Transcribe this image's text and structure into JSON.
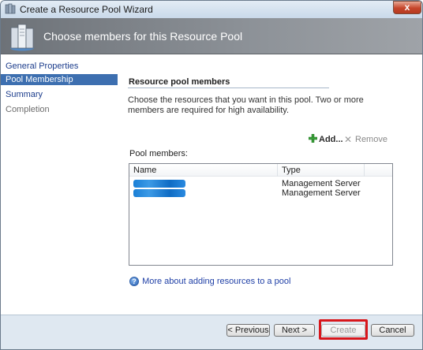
{
  "window": {
    "title": "Create a Resource Pool Wizard",
    "close_label": "x"
  },
  "banner": {
    "title": "Choose members for this Resource Pool"
  },
  "nav": {
    "items": [
      {
        "label": "General Properties",
        "state": "done"
      },
      {
        "label": "Pool Membership",
        "state": "selected"
      },
      {
        "label": "Summary",
        "state": "done"
      },
      {
        "label": "Completion",
        "state": "future"
      }
    ]
  },
  "content": {
    "section_title": "Resource pool members",
    "instructions": "Choose the resources that you want in this pool. Two or more members are required for high availability.",
    "add_label": "Add...",
    "remove_label": "Remove",
    "members_label": "Pool members:",
    "columns": {
      "name": "Name",
      "type": "Type"
    },
    "rows": [
      {
        "name": "",
        "type": "Management Server"
      },
      {
        "name": "",
        "type": "Management Server"
      }
    ],
    "help_link": "More about adding resources to a pool"
  },
  "footer": {
    "previous": "< Previous",
    "next": "Next >",
    "create": "Create",
    "cancel": "Cancel"
  },
  "colors": {
    "selected_nav": "#3d6fb0",
    "highlight": "#d8161b",
    "link": "#1f3fa6"
  }
}
